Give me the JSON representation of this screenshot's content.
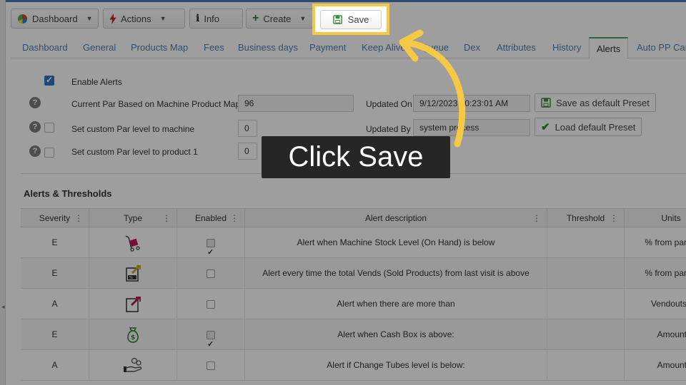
{
  "toolbar": {
    "dashboard": "Dashboard",
    "actions": "Actions",
    "info": "Info",
    "create": "Create",
    "save": "Save"
  },
  "tabs": [
    "Dashboard",
    "General",
    "Products Map",
    "Fees",
    "Business days",
    "Payment",
    "Keep Alive",
    "Queue",
    "Dex",
    "Attributes",
    "History",
    "Alerts",
    "Auto PP Card"
  ],
  "active_tab": "Alerts",
  "form": {
    "enable_alerts": "Enable Alerts",
    "current_par_label": "Current Par Based on Machine Product Map:",
    "current_par_value": "96",
    "custom_par_machine_label": "Set custom Par level to machine",
    "custom_par_machine_value": "0",
    "custom_par_product_label": "Set custom Par level to product 1",
    "custom_par_product_value": "0",
    "updated_on_label": "Updated On",
    "updated_on_value": "9/12/2023 10:23:01 AM",
    "updated_by_label": "Updated By",
    "updated_by_value": "system process",
    "save_preset": "Save as default Preset",
    "load_preset": "Load default Preset"
  },
  "section_title": "Alerts & Thresholds",
  "table": {
    "columns": [
      "Severity",
      "Type",
      "Enabled",
      "Alert description",
      "Threshold",
      "Units"
    ],
    "rows": [
      {
        "severity": "E",
        "type_icon": "cart-icon",
        "enabled": true,
        "description": "Alert when Machine Stock Level (On Hand) is below",
        "threshold": "",
        "units": "% from par"
      },
      {
        "severity": "E",
        "type_icon": "vends-icon",
        "enabled": false,
        "description": "Alert every time the total Vends (Sold Products) from last visit is above",
        "threshold": "",
        "units": "% from par"
      },
      {
        "severity": "A",
        "type_icon": "vendout-icon",
        "enabled": false,
        "description": "Alert when there are more than",
        "threshold": "",
        "units": "Vendouts"
      },
      {
        "severity": "E",
        "type_icon": "cash-bag-icon",
        "enabled": true,
        "description": "Alert when Cash Box is above:",
        "threshold": "",
        "units": "Amount"
      },
      {
        "severity": "A",
        "type_icon": "coins-hand-icon",
        "enabled": false,
        "description": "Alert if Change Tubes level is below:",
        "threshold": "",
        "units": "Amount"
      }
    ]
  },
  "overlay": {
    "callout": "Click Save"
  },
  "colors": {
    "highlight": "#f6c945",
    "link": "#4d80b5",
    "active_tab_border": "#48a56a",
    "callout_bg": "#262626"
  }
}
